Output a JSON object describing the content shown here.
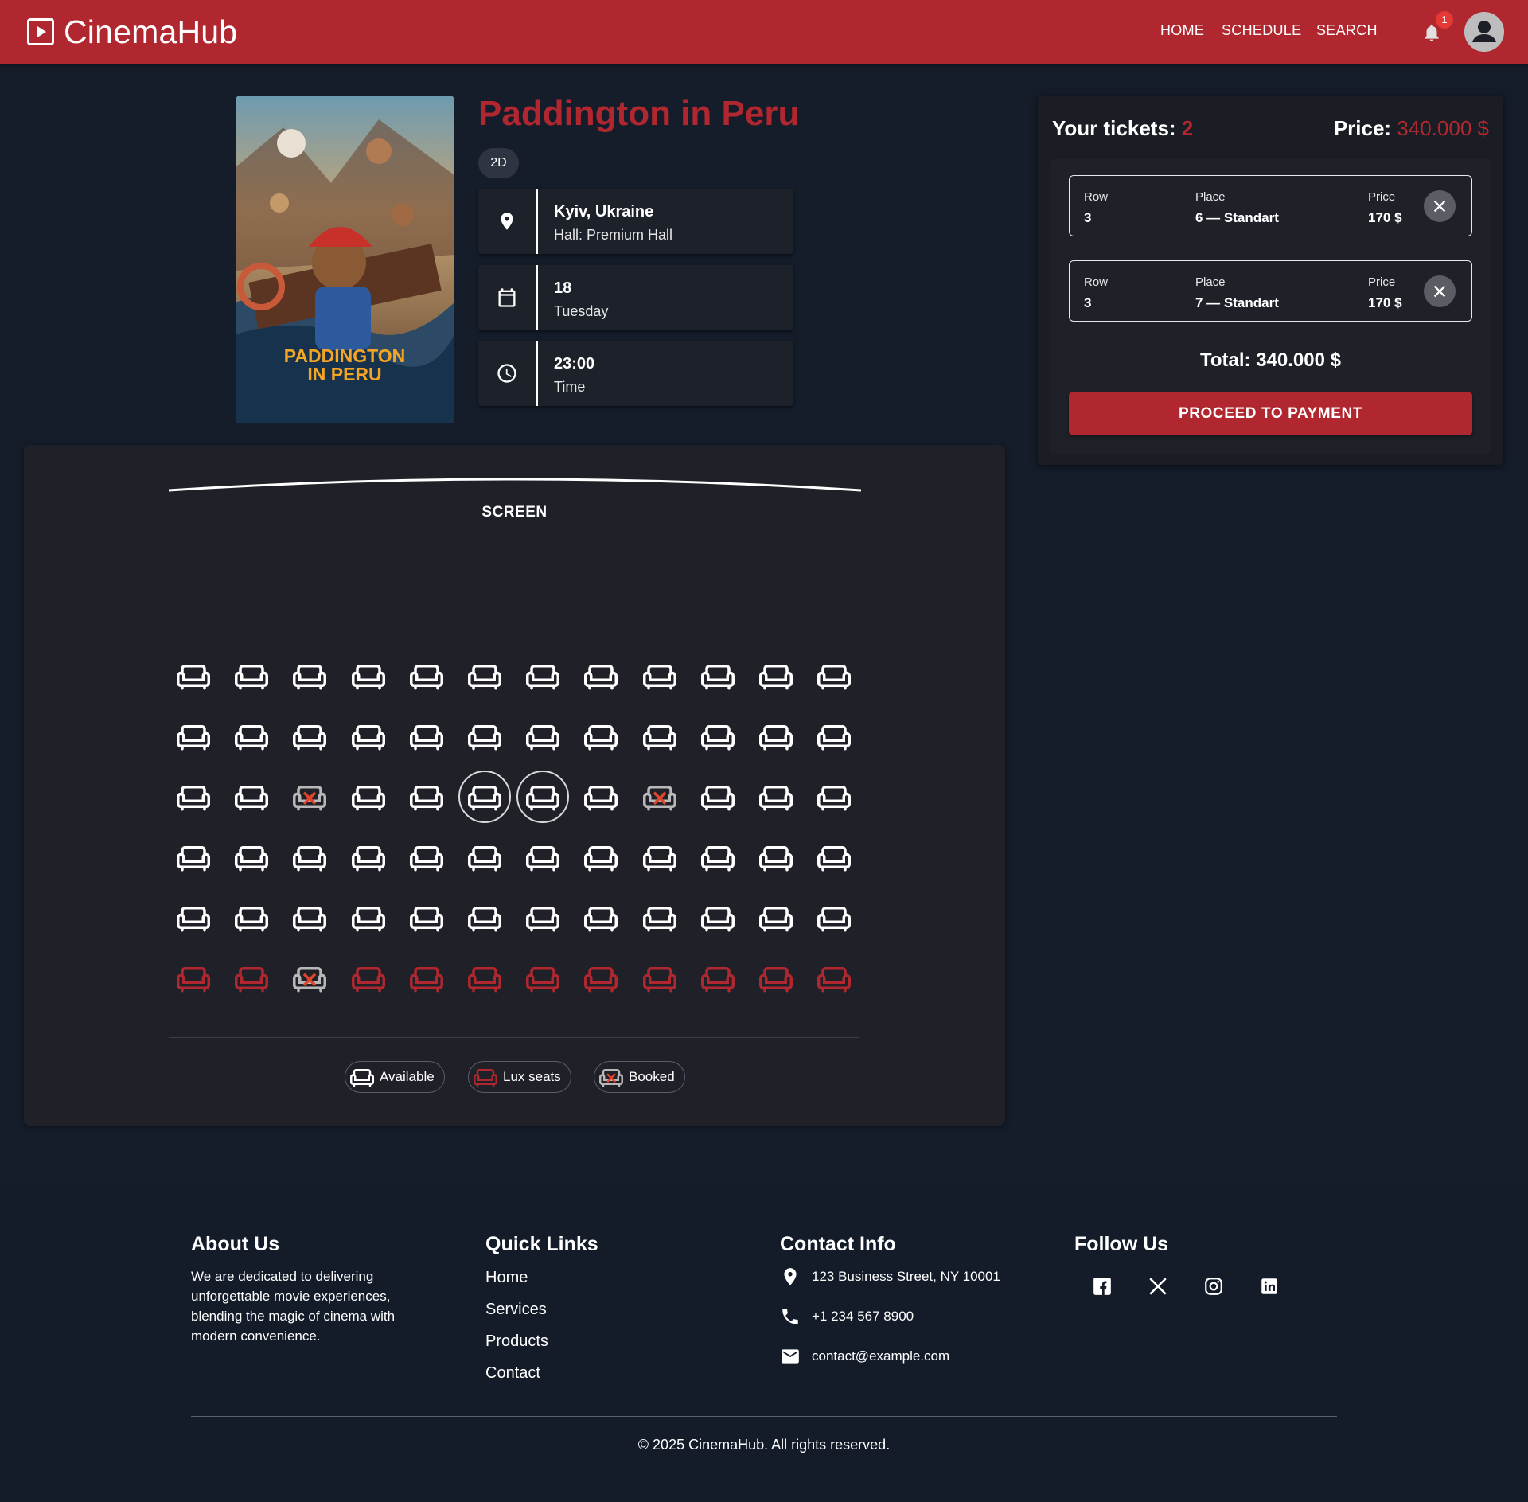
{
  "app": {
    "brand": "CinemaHub",
    "nav": {
      "home": "HOME",
      "schedule": "SCHEDULE",
      "search": "SEARCH"
    },
    "notifications_count": "1"
  },
  "movie": {
    "title": "Paddington in Peru",
    "format": "2D",
    "poster_caption_line1": "PADDINGTON",
    "poster_caption_line2": "IN PERU",
    "location": {
      "city": "Kyiv, Ukraine",
      "hall": "Hall: Premium Hall"
    },
    "date": {
      "day": "18",
      "weekday": "Tuesday"
    },
    "time": {
      "value": "23:00",
      "label": "Time"
    }
  },
  "seat_map": {
    "screen_label": "SCREEN",
    "rows": 6,
    "seats_per_row": 12,
    "lux_row": 6,
    "booked": [
      [
        3,
        3
      ],
      [
        3,
        9
      ],
      [
        6,
        3
      ]
    ],
    "selected": [
      [
        3,
        6
      ],
      [
        3,
        7
      ]
    ],
    "legend": {
      "available": "Available",
      "lux": "Lux seats",
      "booked": "Booked"
    },
    "colors": {
      "available": "#ffffff",
      "lux": "#b0272f",
      "booked": "#b8b8b8",
      "booked_mark": "#e0442c"
    }
  },
  "cart": {
    "tickets_label": "Your tickets:",
    "tickets_count": "2",
    "price_label": "Price:",
    "price_value": "340.000 $",
    "tickets": [
      {
        "row_label": "Row",
        "row": "3",
        "place_label": "Place",
        "place": "6 — Standart",
        "price_label": "Price",
        "price": "170 $"
      },
      {
        "row_label": "Row",
        "row": "3",
        "place_label": "Place",
        "place": "7 — Standart",
        "price_label": "Price",
        "price": "170 $"
      }
    ],
    "total": "Total: 340.000 $",
    "pay_button": "PROCEED TO PAYMENT"
  },
  "footer": {
    "about": {
      "heading": "About Us",
      "text": "We are dedicated to delivering unforgettable movie experiences, blending the magic of cinema with modern convenience."
    },
    "links": {
      "heading": "Quick Links",
      "items": [
        "Home",
        "Services",
        "Products",
        "Contact"
      ]
    },
    "contact": {
      "heading": "Contact Info",
      "address": "123 Business Street, NY 10001",
      "phone": "+1 234 567 8900",
      "email": "contact@example.com"
    },
    "follow": {
      "heading": "Follow Us",
      "networks": [
        "facebook-icon",
        "x-icon",
        "instagram-icon",
        "linkedin-icon"
      ]
    },
    "copyright": "© 2025 CinemaHub. All rights reserved."
  }
}
